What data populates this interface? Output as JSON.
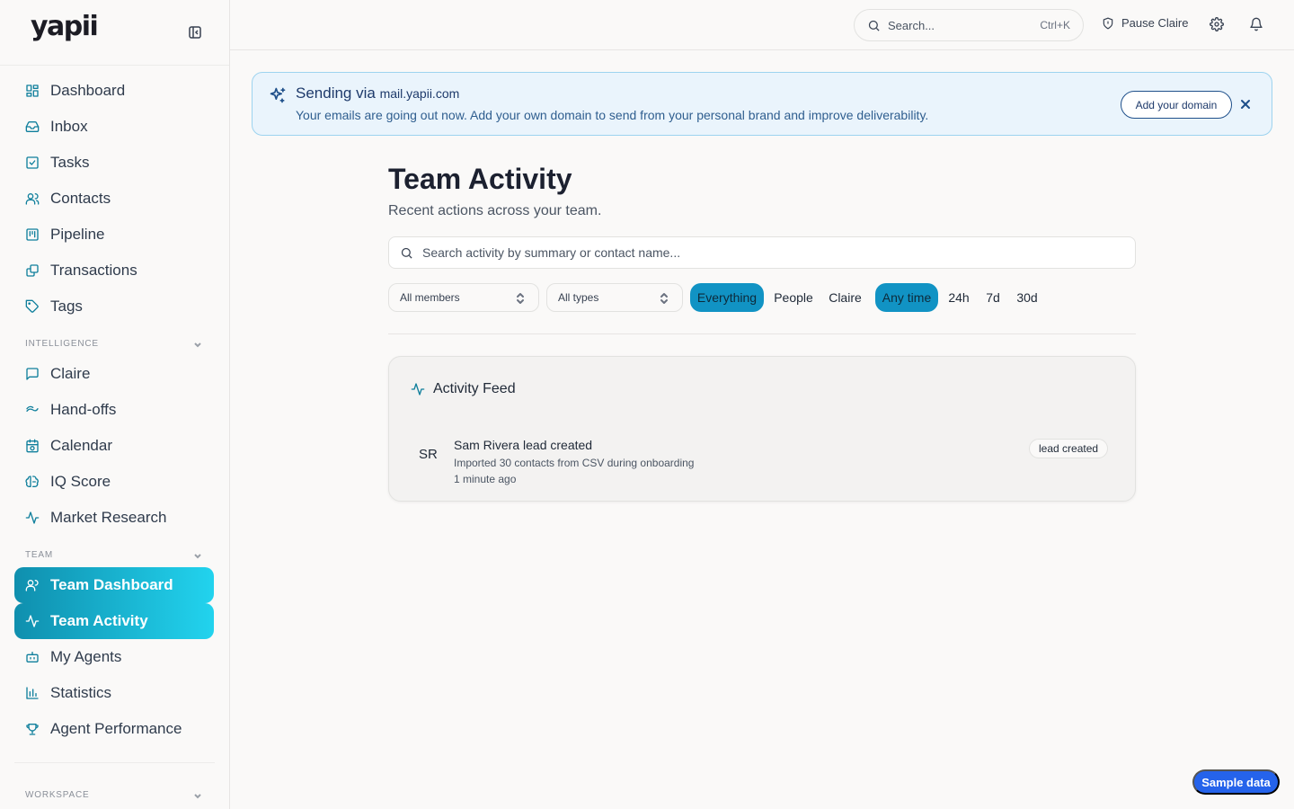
{
  "brand": {
    "logo": "yapii"
  },
  "sidebar": {
    "items": [
      {
        "label": "Dashboard",
        "icon": "dashboard-icon"
      },
      {
        "label": "Inbox",
        "icon": "inbox-icon"
      },
      {
        "label": "Tasks",
        "icon": "tasks-icon"
      },
      {
        "label": "Contacts",
        "icon": "contacts-icon"
      },
      {
        "label": "Pipeline",
        "icon": "pipeline-icon"
      },
      {
        "label": "Transactions",
        "icon": "transactions-icon"
      },
      {
        "label": "Tags",
        "icon": "tag-icon"
      }
    ],
    "intelligence": {
      "label": "INTELLIGENCE",
      "items": [
        {
          "label": "Claire",
          "icon": "chat-icon"
        },
        {
          "label": "Hand-offs",
          "icon": "handoff-icon"
        },
        {
          "label": "Calendar",
          "icon": "calendar-icon"
        },
        {
          "label": "IQ Score",
          "icon": "brain-icon"
        },
        {
          "label": "Market Research",
          "icon": "activity-icon"
        }
      ]
    },
    "team": {
      "label": "TEAM",
      "items": [
        {
          "label": "Team Dashboard",
          "icon": "users-icon",
          "active": true
        },
        {
          "label": "Team Activity",
          "icon": "activity-icon",
          "active": true
        },
        {
          "label": "My Agents",
          "icon": "bot-icon"
        },
        {
          "label": "Statistics",
          "icon": "bar-chart-icon"
        },
        {
          "label": "Agent Performance",
          "icon": "trophy-icon"
        }
      ]
    },
    "workspace": {
      "label": "WORKSPACE"
    }
  },
  "topbar": {
    "search_placeholder": "Search...",
    "shortcut": "Ctrl+K",
    "pause_label": "Pause Claire"
  },
  "banner": {
    "title": "Sending via",
    "domain": "mail.yapii.com",
    "text": "Your emails are going out now. Add your own domain to send from your personal brand and improve deliverability.",
    "button": "Add your domain"
  },
  "main": {
    "title": "Team Activity",
    "subtitle": "Recent actions across your team.",
    "search_placeholder": "Search activity by summary or contact name...",
    "member_filter": "All members",
    "type_filter": "All types",
    "type_chips": [
      "Everything",
      "People",
      "Claire"
    ],
    "time_chips": [
      "Any time",
      "24h",
      "7d",
      "30d"
    ]
  },
  "feed": {
    "title": "Activity Feed",
    "entries": [
      {
        "initials": "SR",
        "title": "Sam Rivera lead created",
        "detail": "Imported 30 contacts from CSV during onboarding",
        "time": "1 minute ago",
        "badge": "lead created"
      }
    ]
  },
  "sample_button": "Sample data",
  "colors": {
    "accent": "#0f7f9c",
    "active_gradient_start": "#0f8fae",
    "active_gradient_end": "#22d3ee",
    "chip_active": "#1193c4",
    "banner_bg": "#eaf4fc",
    "sample_button": "#2563eb"
  }
}
